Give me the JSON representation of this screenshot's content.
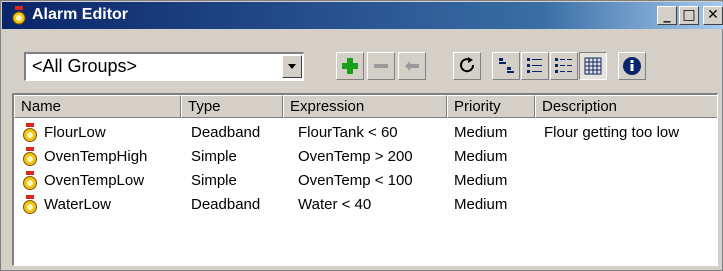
{
  "window": {
    "title": "Alarm Editor",
    "controls": {
      "minimize": "_",
      "maximize": "□",
      "close": "✕"
    }
  },
  "toolbar": {
    "group_filter": {
      "selected": "<All Groups>"
    },
    "buttons": [
      {
        "name": "add-alarm-button",
        "icon": "plus-icon"
      },
      {
        "name": "remove-alarm-button",
        "icon": "minus-icon"
      },
      {
        "name": "edit-alarm-button",
        "icon": "arrow-left-icon"
      },
      {
        "name": "refresh-button",
        "icon": "refresh-icon"
      },
      {
        "name": "small-icons-view-button",
        "icon": "small-icons-icon"
      },
      {
        "name": "list-view-button",
        "icon": "list-icon"
      },
      {
        "name": "details-view-button",
        "icon": "details-icon"
      },
      {
        "name": "grid-view-button",
        "icon": "grid-icon"
      },
      {
        "name": "info-button",
        "icon": "info-icon"
      }
    ],
    "accent_colors": {
      "add": "#1aa01a",
      "info": "#0a246a"
    }
  },
  "list": {
    "columns": [
      "Name",
      "Type",
      "Expression",
      "Priority",
      "Description"
    ],
    "rows": [
      {
        "name": "FlourLow",
        "type": "Deadband",
        "expression": "FlourTank < 60",
        "priority": "Medium",
        "description": "Flour getting too low"
      },
      {
        "name": "OvenTempHigh",
        "type": "Simple",
        "expression": "OvenTemp > 200",
        "priority": "Medium",
        "description": ""
      },
      {
        "name": "OvenTempLow",
        "type": "Simple",
        "expression": "OvenTemp < 100",
        "priority": "Medium",
        "description": ""
      },
      {
        "name": "WaterLow",
        "type": "Deadband",
        "expression": "Water < 40",
        "priority": "Medium",
        "description": ""
      }
    ],
    "row_icon": "alarm-bell-icon"
  }
}
